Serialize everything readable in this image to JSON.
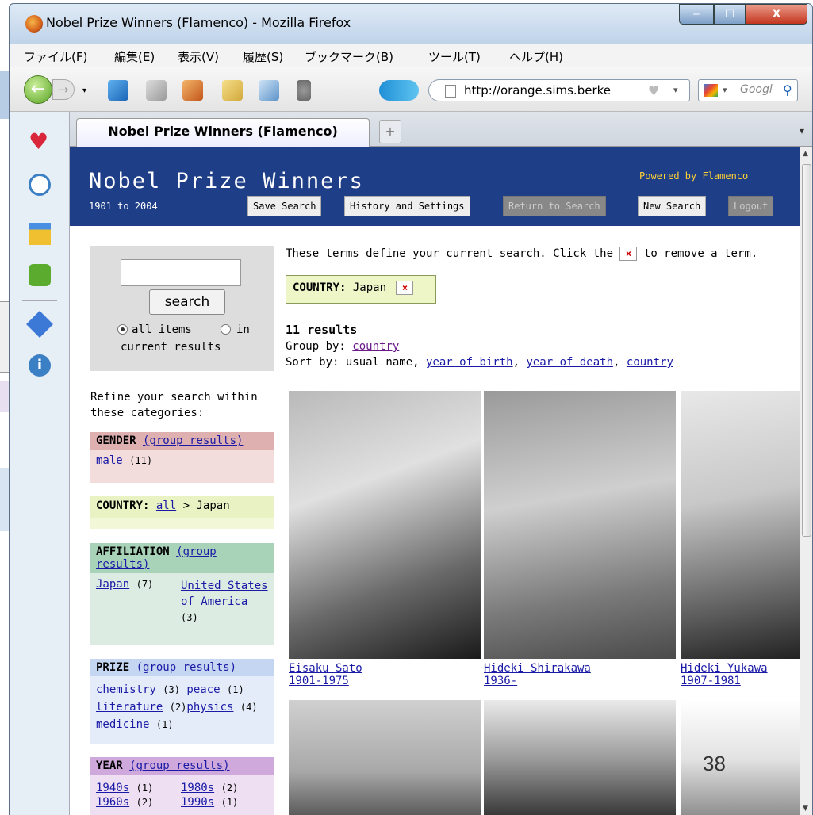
{
  "window": {
    "title": "Nobel Prize Winners (Flamenco) - Mozilla Firefox",
    "min": "‒",
    "max": "☐",
    "close": "X"
  },
  "menu": [
    "ファイル(F)",
    "編集(E)",
    "表示(V)",
    "履歴(S)",
    "ブックマーク(B)",
    "ツール(T)",
    "ヘルプ(H)"
  ],
  "toolbar": {
    "url": "http://orange.sims.berke",
    "search_placeholder": "Googl"
  },
  "tabs": [
    {
      "label": "Nobel Prize Winners (Flamenco)"
    }
  ],
  "header": {
    "title": "Nobel Prize Winners",
    "subtitle": "1901 to 2004",
    "powered": "Powered by Flamenco",
    "buttons": [
      "Save Search",
      "History and Settings",
      "Return to Search",
      "New Search",
      "Logout"
    ]
  },
  "search": {
    "button": "search",
    "opt_all": "all items",
    "opt_in": "in",
    "opt_in2": "current results"
  },
  "refine": {
    "line1": "Refine your search within",
    "line2": "these categories:"
  },
  "facets": {
    "gender": {
      "name": "GENDER",
      "group": "(group results)",
      "items": [
        {
          "label": "male",
          "count": "(11)"
        }
      ]
    },
    "country": {
      "name": "COUNTRY:",
      "all": "all",
      "sep": ">",
      "value": "Japan"
    },
    "affiliation": {
      "name": "AFFILIATION",
      "group": "(group",
      "group2": "results)",
      "items": [
        {
          "label": "Japan",
          "count": "(7)"
        },
        {
          "label": "United States of America",
          "count": "(3)"
        }
      ]
    },
    "prize": {
      "name": "PRIZE",
      "group": "(group results)",
      "items": [
        {
          "label": "chemistry",
          "count": "(3)"
        },
        {
          "label": "peace",
          "count": "(1)"
        },
        {
          "label": "literature",
          "count": "(2)"
        },
        {
          "label": "physics",
          "count": "(4)"
        },
        {
          "label": "medicine",
          "count": "(1)"
        }
      ]
    },
    "year": {
      "name": "YEAR",
      "group": "(group results)",
      "items": [
        {
          "label": "1940s",
          "count": "(1)"
        },
        {
          "label": "1980s",
          "count": "(2)"
        },
        {
          "label": "1960s",
          "count": "(2)"
        },
        {
          "label": "1990s",
          "count": "(1)"
        }
      ]
    }
  },
  "results": {
    "intro_a": "These terms define your current search. Click the",
    "intro_x": "×",
    "intro_b": "to remove a term.",
    "term_name": "COUNTRY:",
    "term_value": "Japan",
    "count": "11 results",
    "group_by": "Group by:",
    "group_link": "country",
    "sort_by": "Sort by: usual name,",
    "sort_links": [
      "year of birth",
      "year of death",
      "country"
    ],
    "people": [
      {
        "name": "Eisaku Sato",
        "years": "1901-1975"
      },
      {
        "name": "Hideki Shirakawa",
        "years": "1936-"
      },
      {
        "name": "Hideki Yukawa",
        "years": "1907-1981"
      }
    ]
  },
  "slide_number": "38"
}
